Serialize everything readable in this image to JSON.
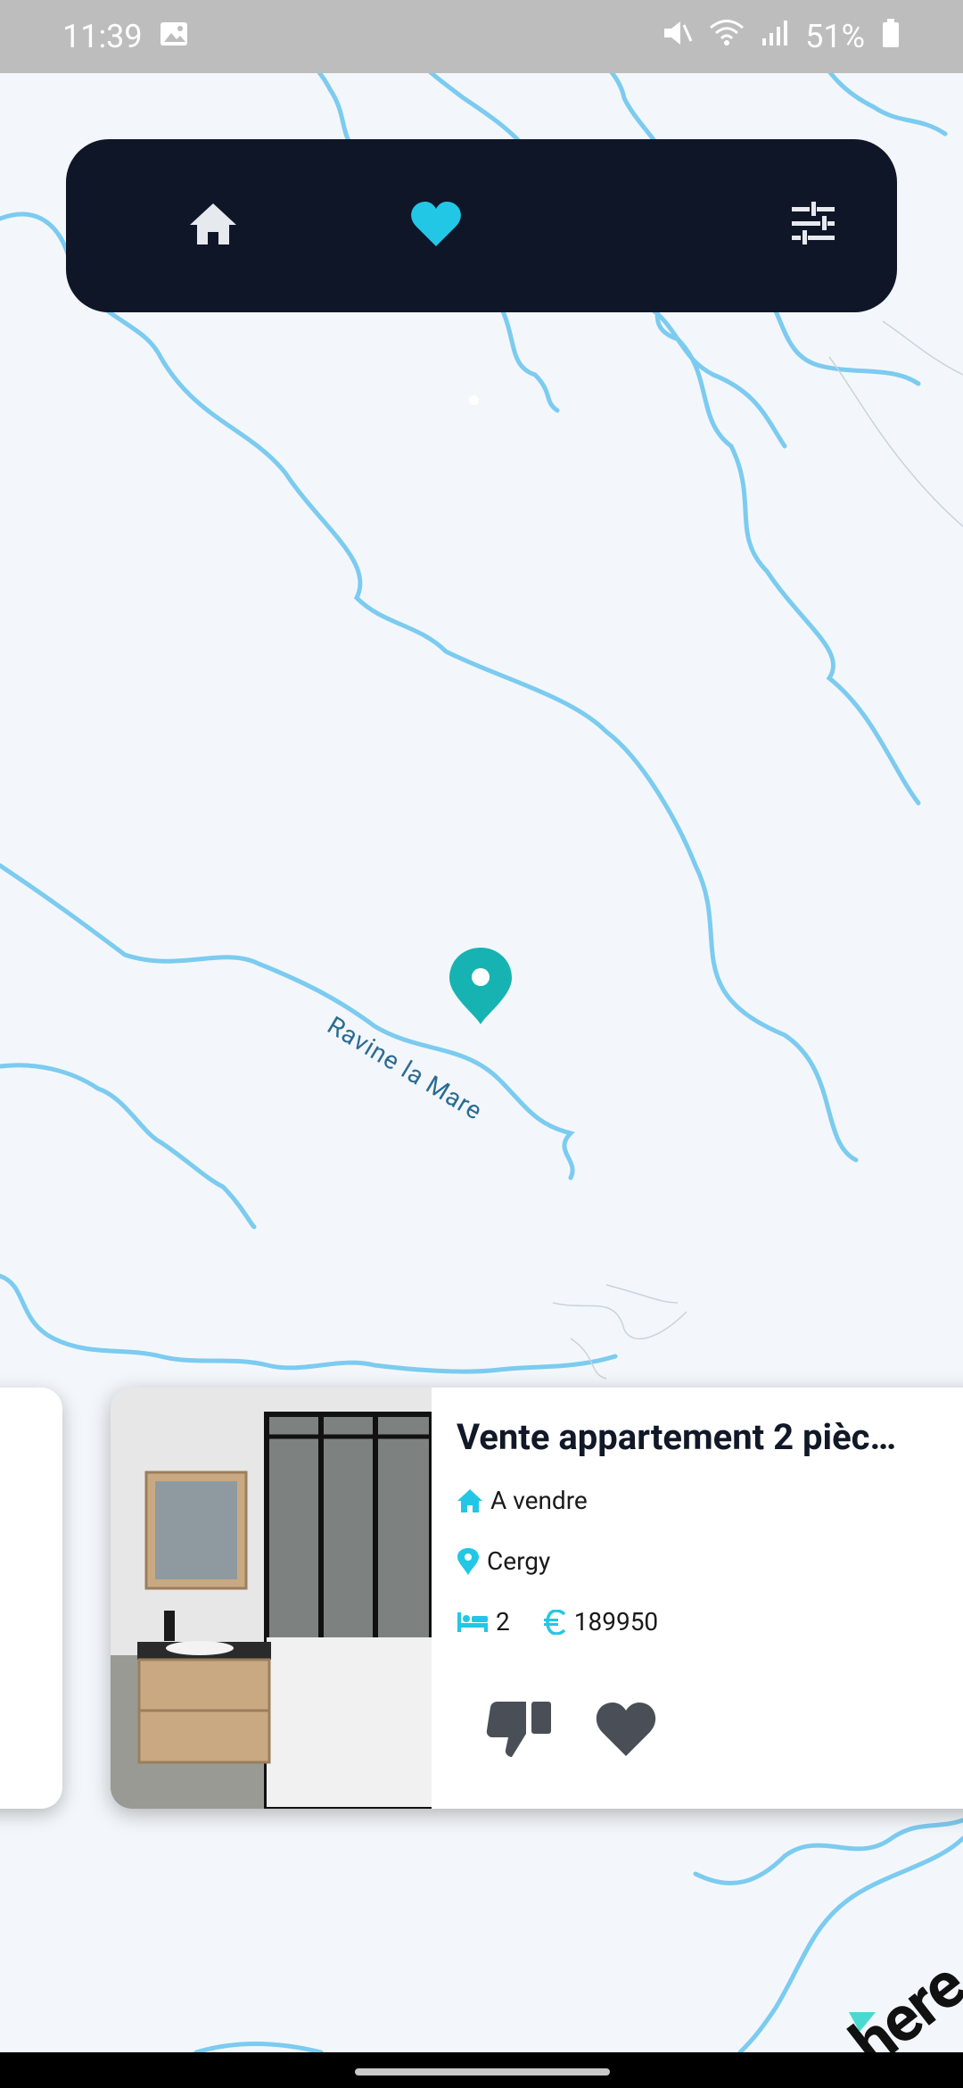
{
  "status_bar": {
    "time": "11:39",
    "battery": "51%"
  },
  "top_nav": {
    "home_icon": "home-icon",
    "favorites_icon": "heart-icon",
    "filters_icon": "sliders-icon",
    "accent": "#22c7e5",
    "background": "#0f1628"
  },
  "map": {
    "labels": {
      "ravine": "Ravine la Mare"
    },
    "water_color": "#7ccbf0",
    "background": "#f3f7fb",
    "pin_color": "#17b3b3"
  },
  "listing": {
    "title": "Vente appartement 2 pièc…",
    "status": "A vendre",
    "city": "Cergy",
    "bedrooms": "2",
    "price": "189950",
    "icons": [
      "house-icon",
      "location-icon",
      "bed-icon",
      "euro-icon"
    ],
    "actions": [
      "thumbs-down-icon",
      "heart-icon"
    ]
  },
  "branding": {
    "logo_text": "here"
  }
}
